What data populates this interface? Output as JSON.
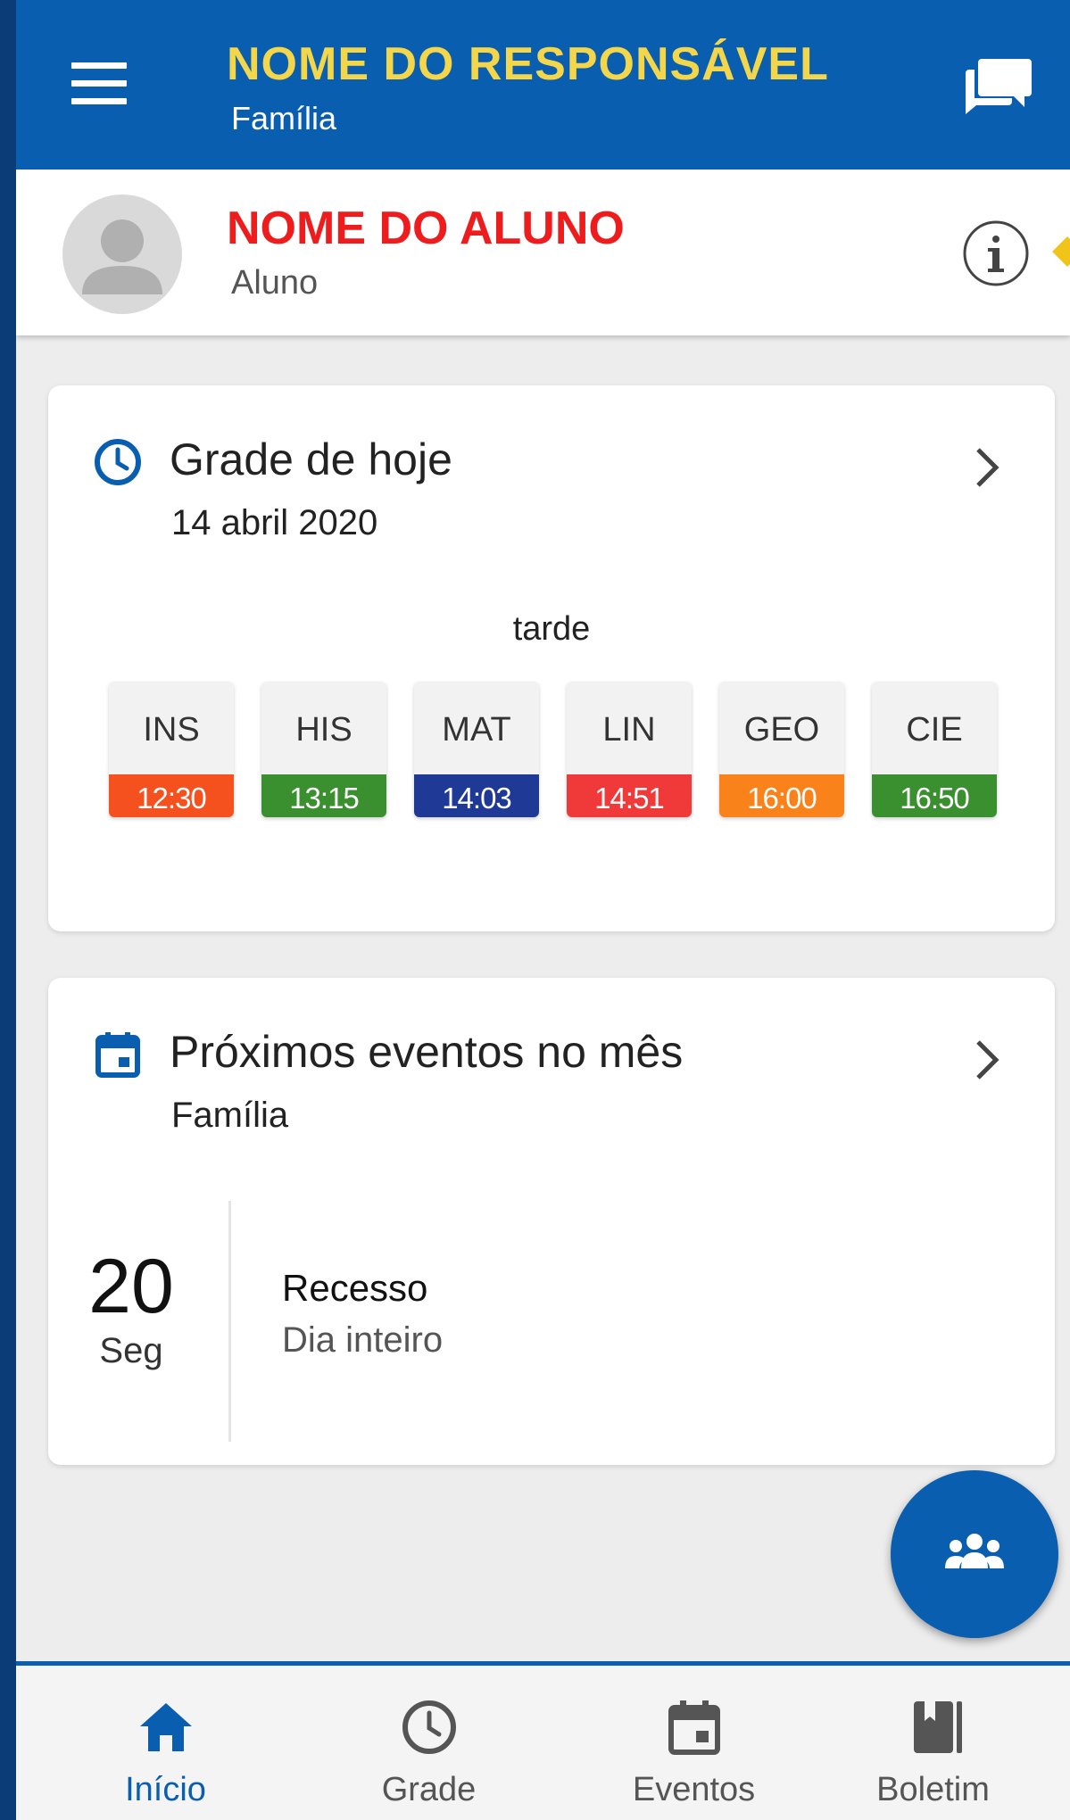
{
  "app_bar": {
    "title": "NOME DO RESPONSÁVEL",
    "subtitle": "Família",
    "menu_icon": "hamburger-menu-icon",
    "chat_icon": "chat-bubbles-icon"
  },
  "student": {
    "name": "NOME DO ALUNO",
    "role": "Aluno",
    "avatar_icon": "person-avatar-icon",
    "info_icon": "info-icon"
  },
  "schedule_card": {
    "icon": "clock-icon",
    "title": "Grade de hoje",
    "date": "14 abril 2020",
    "period_label": "tarde",
    "periods": [
      {
        "subject": "INS",
        "time": "12:30",
        "color": "#f4511e"
      },
      {
        "subject": "HIS",
        "time": "13:15",
        "color": "#3a8f2f"
      },
      {
        "subject": "MAT",
        "time": "14:03",
        "color": "#1f3a96"
      },
      {
        "subject": "LIN",
        "time": "14:51",
        "color": "#f03a3a"
      },
      {
        "subject": "GEO",
        "time": "16:00",
        "color": "#f9821a"
      },
      {
        "subject": "CIE",
        "time": "16:50",
        "color": "#3a8f2f"
      }
    ]
  },
  "events_card": {
    "icon": "calendar-icon",
    "title": "Próximos eventos no mês",
    "subtitle": "Família",
    "events": [
      {
        "day": "20",
        "weekday": "Seg",
        "title": "Recesso",
        "time": "Dia inteiro"
      }
    ]
  },
  "fab": {
    "icon": "group-people-icon"
  },
  "bottom_nav": {
    "items": [
      {
        "label": "Início",
        "icon": "home-icon",
        "active": true
      },
      {
        "label": "Grade",
        "icon": "clock-icon",
        "active": false
      },
      {
        "label": "Eventos",
        "icon": "calendar-icon",
        "active": false
      },
      {
        "label": "Boletim",
        "icon": "book-icon",
        "active": false
      }
    ]
  },
  "colors": {
    "primary": "#0a5eb0",
    "title_yellow": "#f3d64a",
    "student_red": "#ee1c1c",
    "background": "#ededed"
  }
}
